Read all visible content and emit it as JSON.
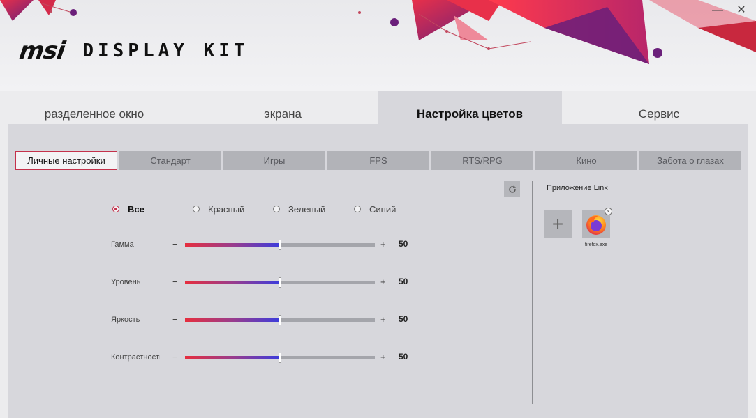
{
  "header": {
    "brand": "msi",
    "product": "DISPLAY KIT",
    "minimize_glyph": "—",
    "close_glyph": "✕"
  },
  "main_tabs": [
    {
      "label": "разделенное окно",
      "active": false
    },
    {
      "label": "экрана",
      "active": false
    },
    {
      "label": "Настройка цветов",
      "active": true
    },
    {
      "label": "Сервис",
      "active": false
    }
  ],
  "sub_tabs": [
    {
      "label": "Личные настройки",
      "active": true
    },
    {
      "label": "Стандарт",
      "active": false
    },
    {
      "label": "Игры",
      "active": false
    },
    {
      "label": "FPS",
      "active": false
    },
    {
      "label": "RTS/RPG",
      "active": false
    },
    {
      "label": "Кино",
      "active": false
    },
    {
      "label": "Забота о глазах",
      "active": false
    }
  ],
  "channels": [
    {
      "label": "Все",
      "selected": true
    },
    {
      "label": "Красный",
      "selected": false
    },
    {
      "label": "Зеленый",
      "selected": false
    },
    {
      "label": "Синий",
      "selected": false
    }
  ],
  "sliders": [
    {
      "label": "Гамма",
      "value": "50",
      "fraction": 0.5,
      "minus": "−",
      "plus": "+"
    },
    {
      "label": "Уровень",
      "value": "50",
      "fraction": 0.5,
      "minus": "−",
      "plus": "+"
    },
    {
      "label": "Яркость",
      "value": "50",
      "fraction": 0.5,
      "minus": "−",
      "plus": "+"
    },
    {
      "label": "Контрастность",
      "value": "50",
      "fraction": 0.5,
      "minus": "−",
      "plus": "+"
    }
  ],
  "reset_icon": "reset-icon",
  "app_link": {
    "title": "Приложение Link",
    "add_glyph": "+",
    "remove_glyph": "×",
    "apps": [
      {
        "name": "firefox.exe",
        "icon": "firefox-icon"
      }
    ]
  },
  "colors": {
    "accent": "#c4314b",
    "slider_start": "#e62e3e",
    "slider_end": "#3c3cdc",
    "panel": "#d7d7dc"
  }
}
